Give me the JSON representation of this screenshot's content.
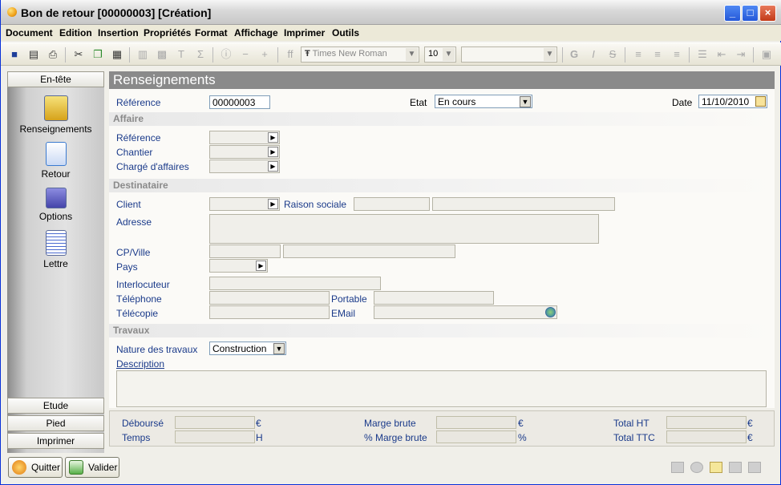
{
  "window": {
    "title": "Bon de retour [00000003] [Création]"
  },
  "menu": [
    "Document",
    "Edition",
    "Insertion",
    "Propriétés",
    "Format",
    "Affichage",
    "Imprimer",
    "Outils"
  ],
  "toolbar": {
    "font_name": "Times New Roman",
    "font_size": "10",
    "style_value": ""
  },
  "sidebar": {
    "top_button": "En-tête",
    "items": [
      {
        "label": "Renseignements",
        "icon": "pda-icon"
      },
      {
        "label": "Retour",
        "icon": "return-icon"
      },
      {
        "label": "Options",
        "icon": "options-icon"
      },
      {
        "label": "Lettre",
        "icon": "letter-icon"
      }
    ],
    "bottom_buttons": [
      "Etude",
      "Pied",
      "Imprimer"
    ]
  },
  "main": {
    "banner": "Renseignements",
    "reference_label": "Référence",
    "reference_value": "00000003",
    "etat_label": "Etat",
    "etat_value": "En cours",
    "date_label": "Date",
    "date_value": "11/10/2010",
    "affaire": {
      "title": "Affaire",
      "reference_label": "Référence",
      "chantier_label": "Chantier",
      "charge_label": "Chargé d'affaires"
    },
    "destinataire": {
      "title": "Destinataire",
      "client_label": "Client",
      "raison_label": "Raison sociale",
      "adresse_label": "Adresse",
      "cpville_label": "CP/Ville",
      "pays_label": "Pays",
      "interlocuteur_label": "Interlocuteur",
      "telephone_label": "Téléphone",
      "portable_label": "Portable",
      "telecopie_label": "Télécopie",
      "email_label": "EMail"
    },
    "travaux": {
      "title": "Travaux",
      "nature_label": "Nature des travaux",
      "nature_value": "Construction",
      "description_label": "Description"
    }
  },
  "footer": {
    "debourse": "Déboursé",
    "temps": "Temps",
    "marge": "Marge brute",
    "pct_marge": "% Marge brute",
    "total_ht": "Total HT",
    "total_ttc": "Total TTC",
    "euro": "€",
    "h": "H",
    "pct": "%"
  },
  "buttons": {
    "quitter": "Quitter",
    "valider": "Valider"
  },
  "colors": {
    "label": "#1a3a8a",
    "section": "#8a8a8a",
    "banner": "#8a8a8a"
  }
}
